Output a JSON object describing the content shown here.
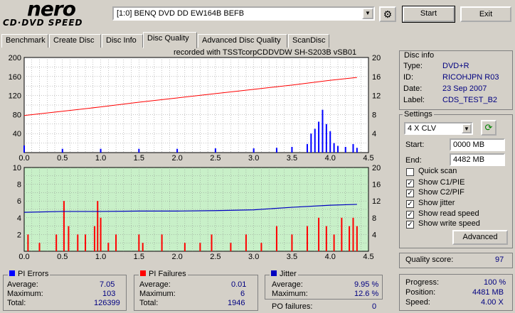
{
  "app": {
    "logo_main": "nero",
    "logo_sub": "CD·DVD SPEED"
  },
  "toolbar": {
    "drive": "[1:0]  BENQ DVD DD EW164B BEFB",
    "start_label": "Start",
    "exit_label": "Exit"
  },
  "tabs": [
    {
      "label": "Benchmark"
    },
    {
      "label": "Create Disc"
    },
    {
      "label": "Disc Info"
    },
    {
      "label": "Disc Quality"
    },
    {
      "label": "Advanced Disc Quality"
    },
    {
      "label": "ScanDisc"
    }
  ],
  "active_tab": "Disc Quality",
  "chart_header": "recorded with TSSTcorpCDDVDW SH-S203B   vSB01",
  "disc_info": {
    "title": "Disc info",
    "type_label": "Type:",
    "type": "DVD+R",
    "id_label": "ID:",
    "id": "RICOHJPN R03",
    "date_label": "Date:",
    "date": "23 Sep 2007",
    "label_label": "Label:",
    "label": "CDS_TEST_B2"
  },
  "settings": {
    "title": "Settings",
    "speed": "4 X CLV",
    "start_label": "Start:",
    "start_value": "0000 MB",
    "end_label": "End:",
    "end_value": "4482 MB",
    "quick_scan": "Quick scan",
    "show_c1": "Show C1/PIE",
    "show_c2": "Show C2/PIF",
    "show_jitter": "Show jitter",
    "show_read": "Show read speed",
    "show_write": "Show write speed",
    "advanced_label": "Advanced"
  },
  "quality": {
    "label": "Quality score:",
    "value": "97"
  },
  "progress": {
    "progress_label": "Progress:",
    "progress_value": "100 %",
    "position_label": "Position:",
    "position_value": "4481 MB",
    "speed_label": "Speed:",
    "speed_value": "4.00 X"
  },
  "pi_errors": {
    "title": "PI Errors",
    "avg_label": "Average:",
    "avg": "7.05",
    "max_label": "Maximum:",
    "max": "103",
    "total_label": "Total:",
    "total": "126399"
  },
  "pi_failures": {
    "title": "PI Failures",
    "avg_label": "Average:",
    "avg": "0.01",
    "max_label": "Maximum:",
    "max": "6",
    "total_label": "Total:",
    "total": "1946"
  },
  "jitter": {
    "title": "Jitter",
    "avg_label": "Average:",
    "avg": "9.95 %",
    "max_label": "Maximum:",
    "max": "12.6 %",
    "po_label": "PO failures:",
    "po": "0"
  },
  "colors": {
    "pie": "#0000ff",
    "pif": "#ff0000",
    "jitter": "#0000c0",
    "speed_line": "#ff0000",
    "bottom_bg": "#c8f0c8",
    "top_bg": "#ffffff"
  },
  "chart_data": [
    {
      "type": "bar",
      "x_ticks": [
        "0.0",
        "0.5",
        "1.0",
        "1.5",
        "2.0",
        "2.5",
        "3.0",
        "3.5",
        "4.0",
        "4.5"
      ],
      "y_left_ticks": [
        "200",
        "160",
        "120",
        "80",
        "40"
      ],
      "y_right_ticks": [
        "20",
        "16",
        "12",
        "8",
        "4"
      ],
      "xlim": [
        0,
        4.5
      ],
      "ylim_left": [
        0,
        200
      ],
      "ylim_right": [
        0,
        20
      ],
      "series": [
        {
          "name": "PI Errors",
          "x": [
            0.0,
            0.5,
            1.0,
            1.5,
            2.0,
            2.5,
            3.0,
            3.3,
            3.5,
            3.7,
            3.75,
            3.8,
            3.85,
            3.9,
            3.95,
            4.0,
            4.05,
            4.1,
            4.2,
            4.3,
            4.35
          ],
          "values": [
            15,
            8,
            8,
            8,
            8,
            9,
            9,
            10,
            12,
            18,
            40,
            50,
            65,
            90,
            60,
            45,
            20,
            14,
            12,
            18,
            10
          ]
        },
        {
          "name": "Read Speed",
          "x": [
            0.0,
            0.5,
            1.0,
            1.5,
            2.0,
            2.5,
            3.0,
            3.5,
            4.0,
            4.35
          ],
          "values": [
            7.8,
            8.7,
            9.6,
            10.6,
            11.5,
            12.4,
            13.3,
            14.2,
            15.2,
            15.8
          ]
        }
      ]
    },
    {
      "type": "bar",
      "x_ticks": [
        "0.0",
        "0.5",
        "1.0",
        "1.5",
        "2.0",
        "2.5",
        "3.0",
        "3.5",
        "4.0",
        "4.5"
      ],
      "y_left_ticks": [
        "10",
        "8",
        "6",
        "4",
        "2"
      ],
      "y_right_ticks": [
        "20",
        "16",
        "12",
        "8",
        "4"
      ],
      "xlim": [
        0,
        4.5
      ],
      "ylim_left": [
        0,
        10
      ],
      "ylim_right": [
        0,
        20
      ],
      "series": [
        {
          "name": "PI Failures",
          "x": [
            0.05,
            0.2,
            0.42,
            0.52,
            0.58,
            0.7,
            0.8,
            0.92,
            0.96,
            1.0,
            1.1,
            1.2,
            1.5,
            1.55,
            1.8,
            2.1,
            2.3,
            2.45,
            2.7,
            2.9,
            3.1,
            3.3,
            3.5,
            3.7,
            3.85,
            3.95,
            4.05,
            4.15,
            4.25,
            4.3,
            4.35
          ],
          "values": [
            2,
            1,
            2,
            6,
            3,
            2,
            2,
            3,
            6,
            4,
            1,
            2,
            2,
            1,
            2,
            1,
            1,
            2,
            1,
            2,
            1,
            3,
            2,
            3,
            4,
            3,
            2,
            4,
            3,
            4,
            3
          ]
        },
        {
          "name": "Jitter",
          "x": [
            0.0,
            0.5,
            1.0,
            1.5,
            2.0,
            2.5,
            3.0,
            3.5,
            4.0,
            4.35
          ],
          "values": [
            9.3,
            9.5,
            9.5,
            9.6,
            9.6,
            9.7,
            9.9,
            10.5,
            11.0,
            11.2
          ]
        }
      ]
    }
  ]
}
